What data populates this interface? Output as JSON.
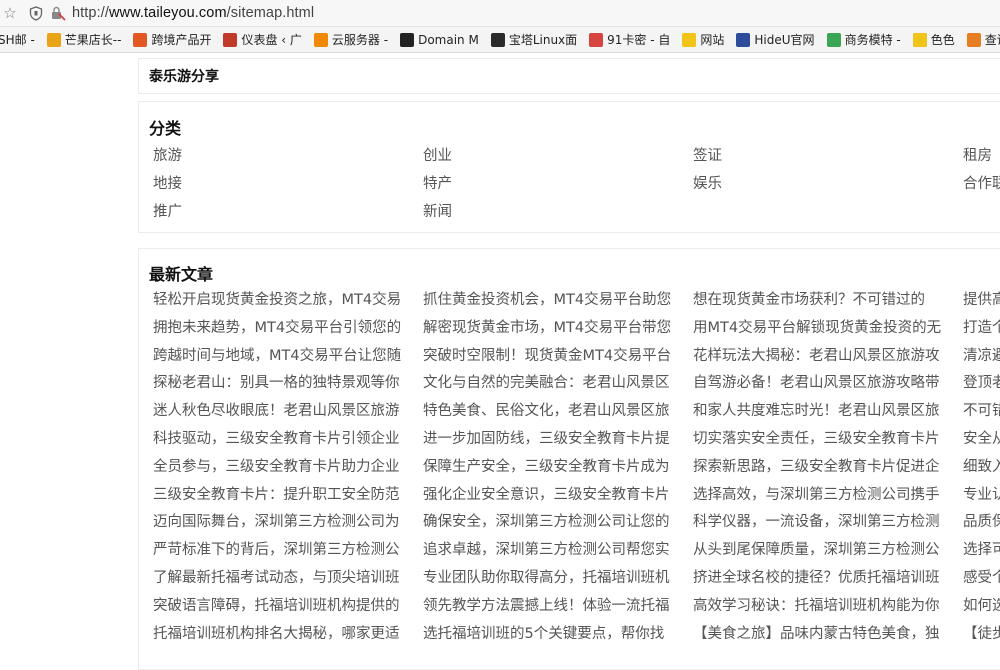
{
  "browser": {
    "url_prefix": "http://",
    "url_host": "www.taileyou.com",
    "url_path": "/sitemap.html",
    "bookmarks": [
      {
        "label": "SH邮 -",
        "icon": "mail-icon",
        "color": "#888888"
      },
      {
        "label": "芒果店长--",
        "icon": "mango-icon",
        "color": "#e8a317"
      },
      {
        "label": "跨境产品开",
        "icon": "flag-icon",
        "color": "#e25822"
      },
      {
        "label": "仪表盘 ‹ 广",
        "icon": "wp-icon",
        "color": "#c0392b"
      },
      {
        "label": "云服务器 -",
        "icon": "cloud-icon",
        "color": "#f08a00"
      },
      {
        "label": "Domain M",
        "icon": "g-icon",
        "color": "#222222"
      },
      {
        "label": "宝塔Linux面",
        "icon": "bt-icon",
        "color": "#2b2b2b"
      },
      {
        "label": "91卡密 - 自",
        "icon": "card-icon",
        "color": "#d64541"
      },
      {
        "label": "网站",
        "icon": "folder-icon",
        "color": "#f0c419"
      },
      {
        "label": "HideU官网",
        "icon": "h-icon",
        "color": "#2b4c9b"
      },
      {
        "label": "商务模特 -",
        "icon": "person-icon",
        "color": "#3aa655"
      },
      {
        "label": "色色",
        "icon": "folder-icon",
        "color": "#f0c419"
      },
      {
        "label": "查询域",
        "icon": "globe-icon",
        "color": "#e67e22"
      }
    ]
  },
  "site": {
    "header_title": "泰乐游分享"
  },
  "categories": {
    "title": "分类",
    "items": [
      "旅游",
      "创业",
      "签证",
      "租房",
      "地接",
      "特产",
      "娱乐",
      "合作联",
      "推广",
      "新闻"
    ]
  },
  "latest": {
    "title": "最新文章",
    "columns": [
      [
        "轻松开启现货黄金投资之旅，MT4交易",
        "拥抱未来趋势，MT4交易平台引领您的",
        "跨越时间与地域，MT4交易平台让您随",
        "探秘老君山：别具一格的独特景观等你",
        "迷人秋色尽收眼底！老君山风景区旅游",
        "科技驱动，三级安全教育卡片引领企业",
        "全员参与，三级安全教育卡片助力企业",
        "三级安全教育卡片：提升职工安全防范",
        "迈向国际舞台，深圳第三方检测公司为",
        "严苛标准下的背后，深圳第三方检测公",
        "了解最新托福考试动态，与顶尖培训班",
        "突破语言障碍，托福培训班机构提供的",
        "托福培训班机构排名大揭秘，哪家更适"
      ],
      [
        "抓住黄金投资机会，MT4交易平台助您",
        "解密现货黄金市场，MT4交易平台带您",
        "突破时空限制！现货黄金MT4交易平台",
        "文化与自然的完美融合：老君山风景区",
        "特色美食、民俗文化，老君山风景区旅",
        "进一步加固防线，三级安全教育卡片提",
        "保障生产安全，三级安全教育卡片成为",
        "强化企业安全意识，三级安全教育卡片",
        "确保安全，深圳第三方检测公司让您的",
        "追求卓越，深圳第三方检测公司帮您实",
        "专业团队助你取得高分，托福培训班机",
        "领先教学方法震撼上线！体验一流托福",
        "选托福培训班的5个关键要点，帮你找"
      ],
      [
        "想在现货黄金市场获利？不可错过的",
        "用MT4交易平台解锁现货黄金投资的无",
        "花样玩法大揭秘：老君山风景区旅游攻",
        "自驾游必备！老君山风景区旅游攻略带",
        "和家人共度难忘时光！老君山风景区旅",
        "切实落实安全责任，三级安全教育卡片",
        "探索新思路，三级安全教育卡片促进企",
        "选择高效，与深圳第三方检测公司携手",
        "科学仪器，一流设备，深圳第三方检测",
        "从头到尾保障质量，深圳第三方检测公",
        "挤进全球名校的捷径？优质托福培训班",
        "高效学习秘诀：托福培训班机构能为你",
        "【美食之旅】品味内蒙古特色美食，独"
      ],
      [
        "提供高",
        "打造个",
        "清凉避",
        "登顶老",
        "不可错",
        "安全从",
        "细致入",
        "专业认",
        "品质保",
        "选择可",
        "感受个",
        "如何选",
        "【徒步"
      ]
    ]
  }
}
